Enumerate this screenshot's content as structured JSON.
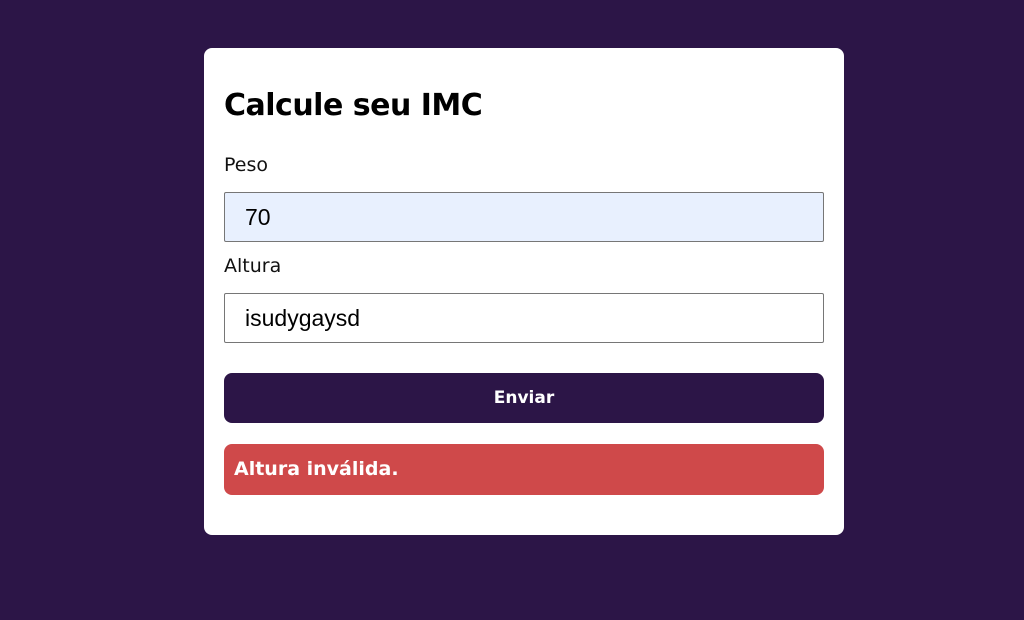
{
  "form": {
    "title": "Calcule seu IMC",
    "peso_label": "Peso",
    "peso_value": "70",
    "altura_label": "Altura",
    "altura_value": "isudygaysd",
    "submit_label": "Enviar",
    "error_message": "Altura inválida."
  },
  "colors": {
    "background": "#2c1547",
    "button": "#2c1547",
    "error": "#cf494a",
    "autofill": "#e8f0fe"
  }
}
